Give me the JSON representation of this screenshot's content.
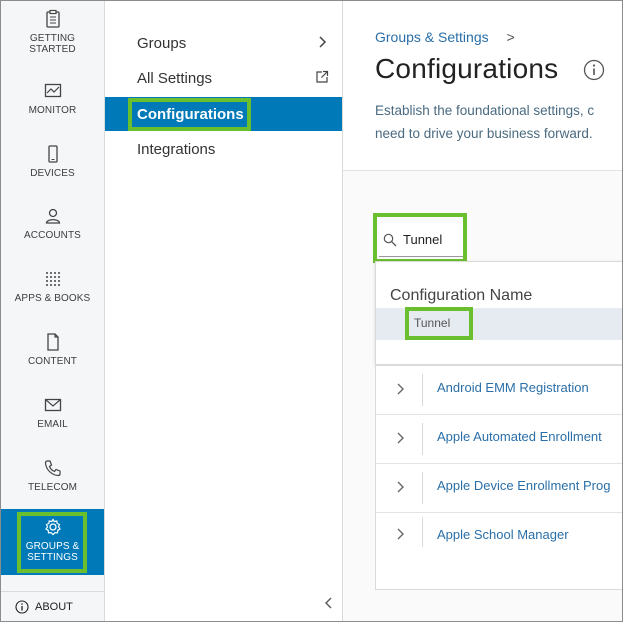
{
  "rail": {
    "items": [
      {
        "label_line1": "GETTING",
        "label_line2": "STARTED",
        "icon": "clipboard-icon"
      },
      {
        "label_line1": "MONITOR",
        "icon": "monitor-icon"
      },
      {
        "label_line1": "DEVICES",
        "icon": "phone-icon"
      },
      {
        "label_line1": "ACCOUNTS",
        "icon": "user-icon"
      },
      {
        "label_line1": "APPS & BOOKS",
        "icon": "grid-icon"
      },
      {
        "label_line1": "CONTENT",
        "icon": "file-icon"
      },
      {
        "label_line1": "EMAIL",
        "icon": "envelope-icon"
      },
      {
        "label_line1": "TELECOM",
        "icon": "phone-handset-icon"
      },
      {
        "label_line1": "GROUPS &",
        "label_line2": "SETTINGS",
        "icon": "gear-icon"
      }
    ],
    "about": "ABOUT"
  },
  "subnav": {
    "groups": "Groups",
    "all_settings": "All Settings",
    "configurations": "Configurations",
    "integrations": "Integrations"
  },
  "main": {
    "breadcrumb": "Groups & Settings",
    "breadcrumb_sep": ">",
    "title": "Configurations",
    "description_line1": "Establish the foundational settings, c",
    "description_line2": "need to drive your business forward.",
    "search_value": "Tunnel",
    "dropdown_header": "Configuration Name",
    "dropdown_result": "Tunnel",
    "rows": [
      "Android EMM Registration",
      "Apple Automated Enrollment",
      "Apple Device Enrollment Prog",
      "Apple School Manager"
    ]
  },
  "colors": {
    "accent": "#0079b8",
    "highlight": "#6abf2e",
    "link": "#2a6fa8"
  }
}
